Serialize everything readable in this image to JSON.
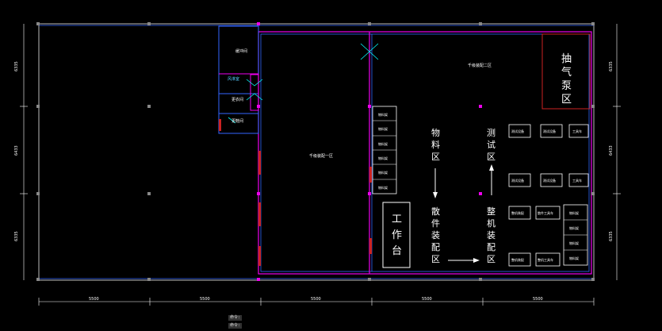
{
  "rooms": {
    "buffer_room": "缓冲间",
    "air_shower": "风淋室",
    "changing_room": "更衣间",
    "shoe_room": "更鞋间",
    "assembly_one": "千级装配一区",
    "assembly_two": "千级装配二区",
    "pump_zone": [
      "抽",
      "气",
      "泵",
      "区"
    ]
  },
  "zones": {
    "material": [
      "物",
      "料",
      "区"
    ],
    "test": [
      "测",
      "试",
      "区"
    ],
    "parts_assembly": [
      "散",
      "件",
      "装",
      "配",
      "区"
    ],
    "machine_assembly": [
      "整",
      "机",
      "装",
      "配",
      "区"
    ],
    "workbench": [
      "工",
      "作",
      "台"
    ]
  },
  "racks": [
    "物料架",
    "物料架",
    "物料架",
    "物料架",
    "物料架",
    "物料架"
  ],
  "right_racks": [
    "物料架",
    "物料架",
    "物料架",
    "物料架"
  ],
  "test_boxes": [
    "测试设备",
    "测试设备",
    "工具车",
    "测试设备",
    "测试设备",
    "工具车"
  ],
  "assembly_boxes": [
    "整机装配",
    "散件工具车",
    "整机装配",
    "整机工具车"
  ],
  "dimensions": {
    "bottom": [
      "5500",
      "5500",
      "5500",
      "5500",
      "5500"
    ],
    "left": [
      "6335",
      "6433",
      "6335"
    ],
    "right": [
      "6335",
      "6433",
      "6335"
    ]
  },
  "status_lines": [
    "命令:",
    "命令:"
  ]
}
